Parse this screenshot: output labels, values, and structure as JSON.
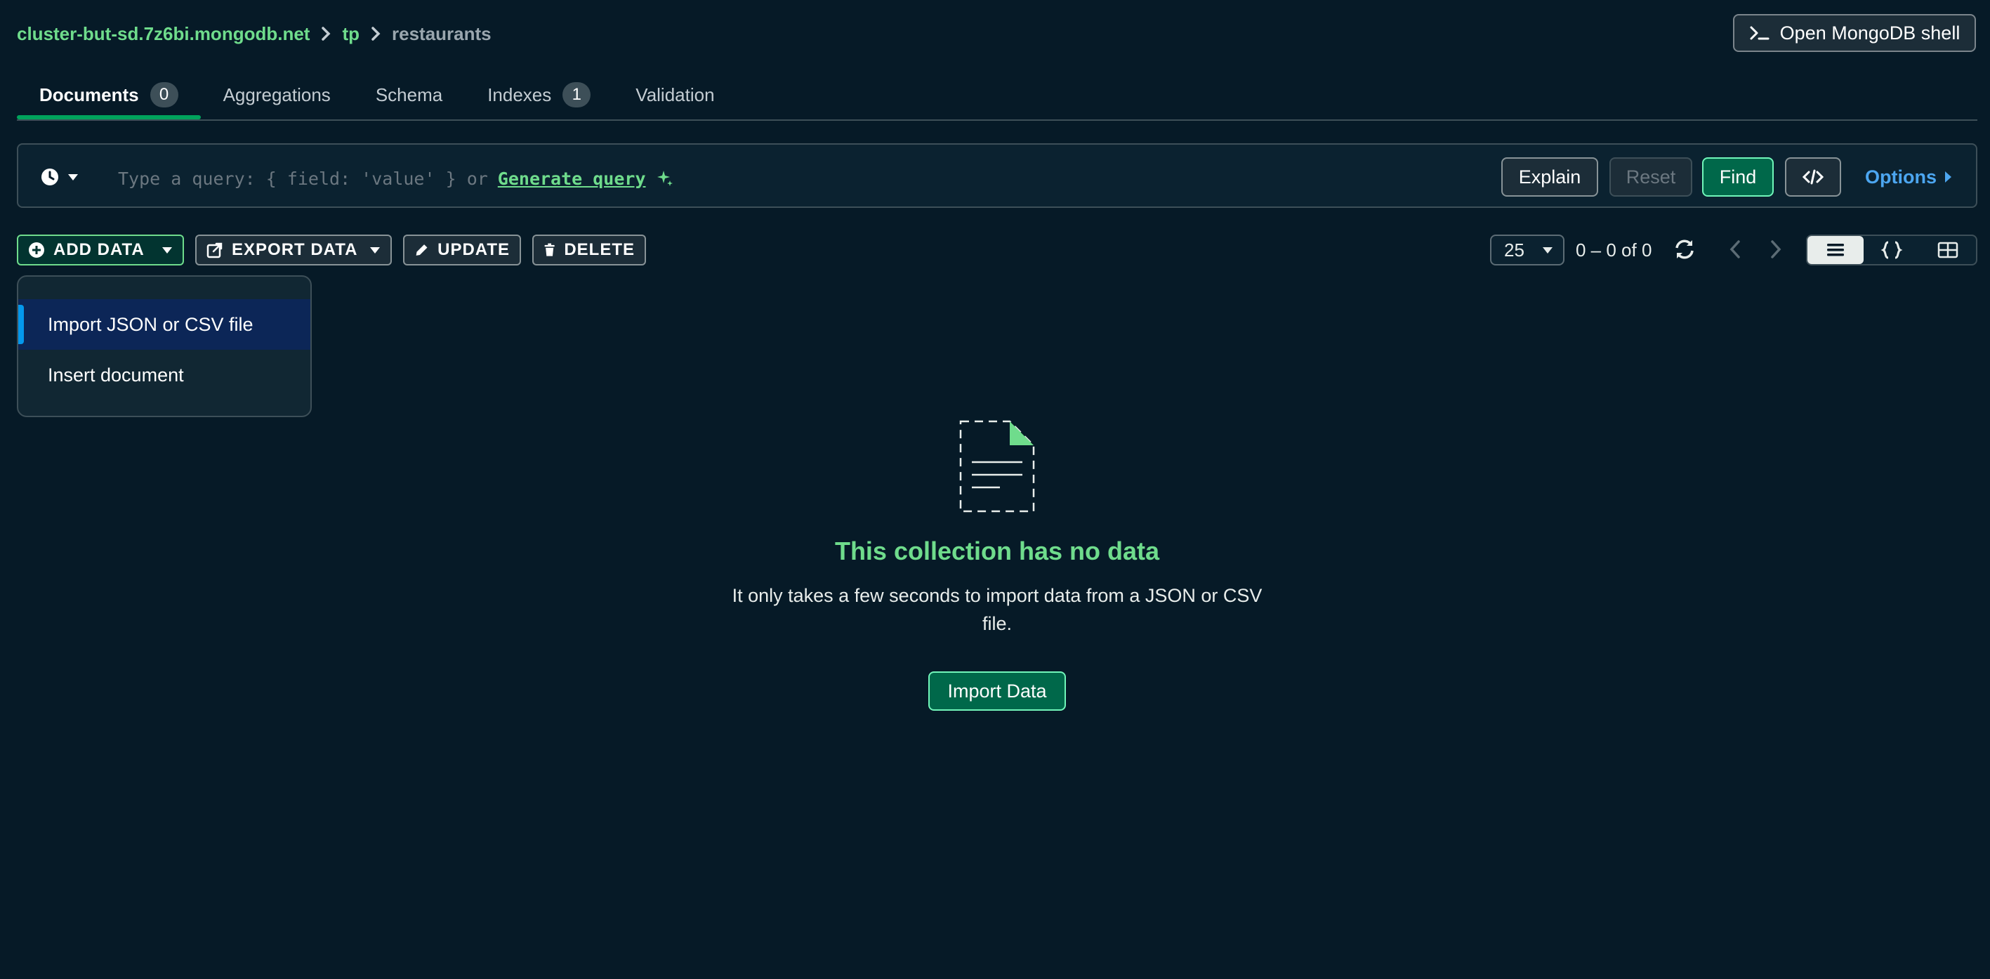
{
  "breadcrumb": {
    "cluster": "cluster-but-sd.7z6bi.mongodb.net",
    "database": "tp",
    "collection": "restaurants"
  },
  "shell_button": {
    "label": "Open MongoDB shell",
    "icon": "terminal-icon"
  },
  "tabs": [
    {
      "label": "Documents",
      "badge": "0",
      "active": true
    },
    {
      "label": "Aggregations"
    },
    {
      "label": "Schema"
    },
    {
      "label": "Indexes",
      "badge": "1"
    },
    {
      "label": "Validation"
    }
  ],
  "query_bar": {
    "placeholder_prefix": "Type a query: { field: 'value' } or",
    "generate_link": "Generate query",
    "explain": "Explain",
    "reset": "Reset",
    "find": "Find",
    "options": "Options"
  },
  "toolbar": {
    "add_data": "ADD DATA",
    "export_data": "EXPORT DATA",
    "update": "UPDATE",
    "delete": "DELETE"
  },
  "pagination": {
    "page_size": "25",
    "range": "0 – 0 of 0"
  },
  "add_data_menu": {
    "items": [
      "Import JSON or CSV file",
      "Insert document"
    ],
    "highlighted": "Import JSON or CSV file"
  },
  "empty_state": {
    "title": "This collection has no data",
    "text": "It only takes a few seconds to import data from a JSON or CSV file.",
    "button": "Import Data"
  },
  "colors": {
    "background": "#061a27",
    "accent_green": "#6fdc8c",
    "find_button": "#00684a",
    "link_blue": "#4ca6f0",
    "menu_highlight": "#0c2657"
  }
}
